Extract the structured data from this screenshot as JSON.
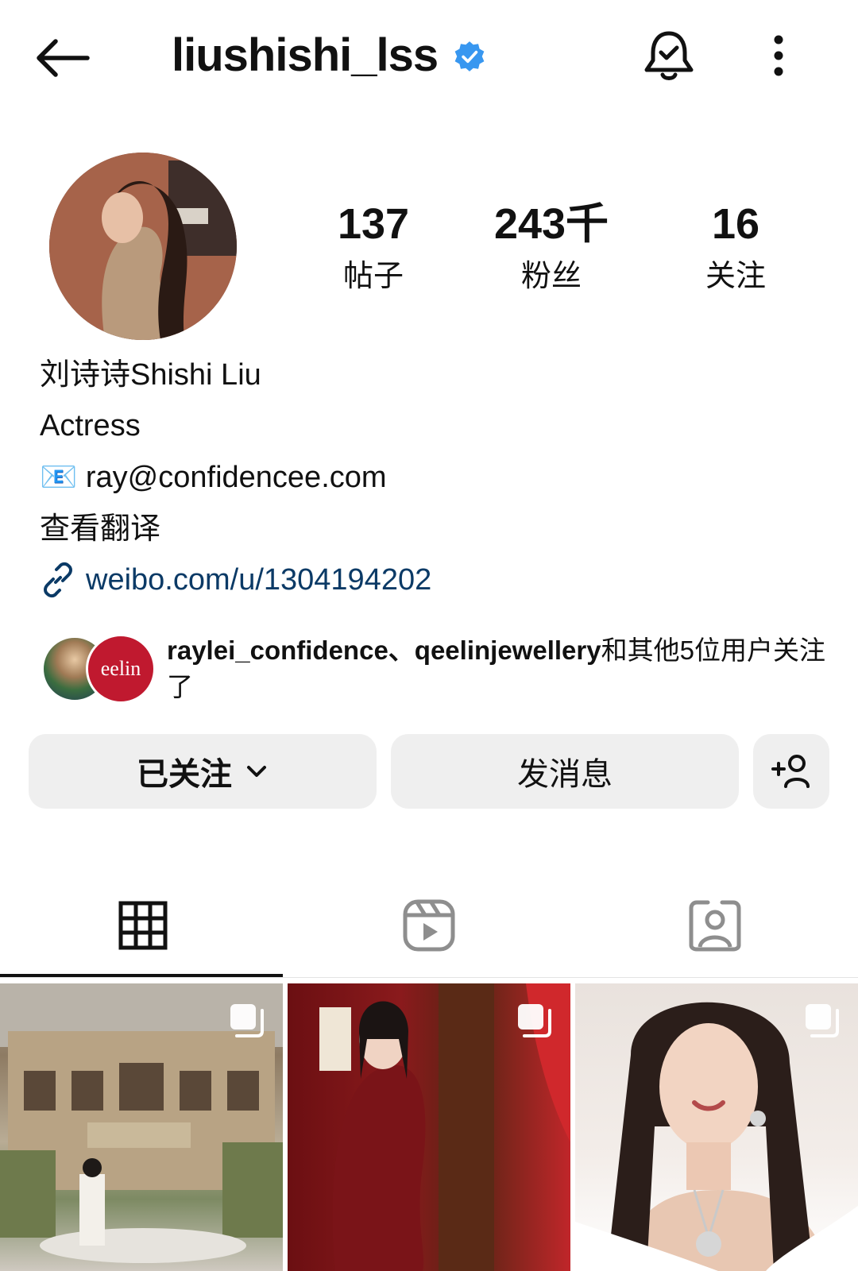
{
  "header": {
    "username": "liushishi_lss",
    "verified": true,
    "icons": [
      "back-arrow-icon",
      "verified-badge-icon",
      "notification-bell-icon",
      "more-options-icon"
    ]
  },
  "profile": {
    "stats": [
      {
        "value": "137",
        "label": "帖子"
      },
      {
        "value": "243千",
        "label": "粉丝"
      },
      {
        "value": "16",
        "label": "关注"
      }
    ],
    "display_name": "刘诗诗Shishi Liu",
    "category": "Actress",
    "email_line": "ray@confidencee.com",
    "email_emoji": "📧",
    "translate_label": "查看翻译",
    "link": "weibo.com/u/1304194202"
  },
  "followed_by": {
    "names": "raylei_confidence、qeelinjewellery",
    "suffix": "和其他5位用户关注了",
    "avatar2_text": "eelin"
  },
  "actions": {
    "follow_label": "已关注",
    "message_label": "发消息"
  },
  "tabs": [
    "posts-grid",
    "reels",
    "tagged"
  ],
  "colors": {
    "verified_blue": "#3897f0",
    "link_blue": "#0b3a66",
    "button_bg": "#efefef"
  }
}
